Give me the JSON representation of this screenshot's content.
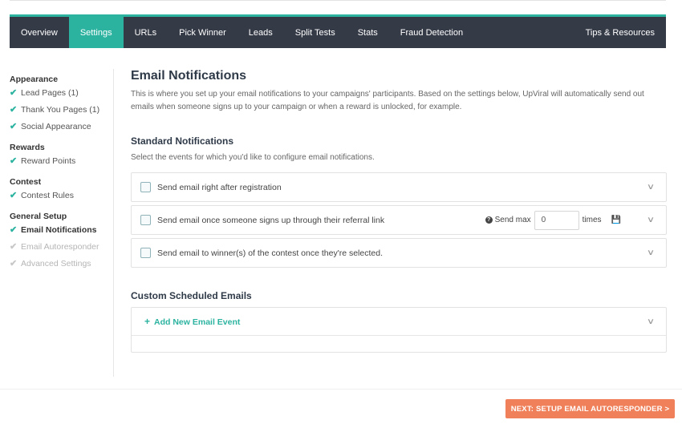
{
  "nav": {
    "items": [
      "Overview",
      "Settings",
      "URLs",
      "Pick Winner",
      "Leads",
      "Split Tests",
      "Stats",
      "Fraud Detection"
    ],
    "active_index": 1,
    "right_item": "Tips & Resources",
    "accent_color": "#2cb3a0",
    "background_color": "#353a47"
  },
  "sidebar": {
    "groups": [
      {
        "title": "Appearance",
        "items": [
          {
            "label": "Lead Pages (1)",
            "state": "done"
          },
          {
            "label": "Thank You Pages (1)",
            "state": "done"
          },
          {
            "label": "Social Appearance",
            "state": "done"
          }
        ]
      },
      {
        "title": "Rewards",
        "items": [
          {
            "label": "Reward Points",
            "state": "done"
          }
        ]
      },
      {
        "title": "Contest",
        "items": [
          {
            "label": "Contest Rules",
            "state": "done"
          }
        ]
      },
      {
        "title": "General Setup",
        "items": [
          {
            "label": "Email Notifications",
            "state": "current"
          },
          {
            "label": "Email Autoresponder",
            "state": "todo"
          },
          {
            "label": "Advanced Settings",
            "state": "todo"
          }
        ]
      }
    ],
    "check_icon": "check-icon"
  },
  "main": {
    "title": "Email Notifications",
    "intro": "This is where you set up your email notifications to your campaigns' participants. Based on the settings below, UpViral will automatically send out emails when someone signs up to your campaign or when a reward is unlocked, for example.",
    "standard": {
      "title": "Standard Notifications",
      "subtitle": "Select the events for which you'd like to configure email notifications.",
      "rows": [
        {
          "label": "Send email right after registration",
          "checked": false
        },
        {
          "label": "Send email once someone signs up through their referral link",
          "checked": false
        },
        {
          "label": "Send email to winner(s) of the contest once they're selected.",
          "checked": false
        }
      ],
      "send_max_label": "Send max",
      "send_max_value": "0",
      "times_label": "times"
    },
    "custom": {
      "title": "Custom Scheduled Emails",
      "add_label": "Add New Email Event"
    }
  },
  "footer": {
    "next_button": "NEXT: SETUP EMAIL AUTORESPONDER >",
    "button_color": "#f0805a"
  }
}
